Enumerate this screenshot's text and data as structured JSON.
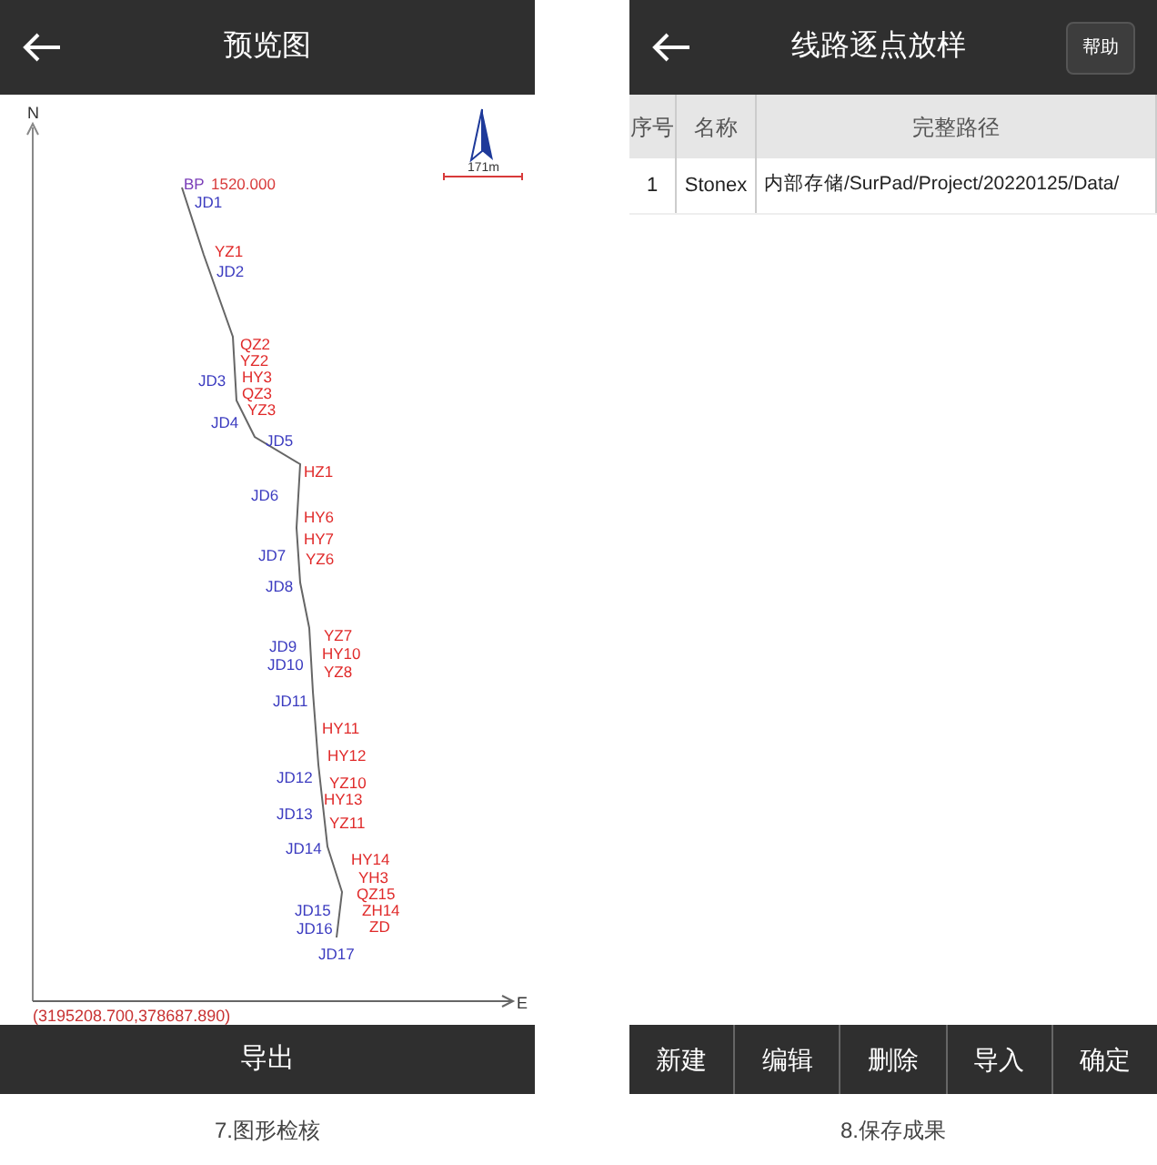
{
  "left_screen": {
    "title": "预览图",
    "map": {
      "north_label": "N",
      "east_label": "E",
      "scale": "171m",
      "coordinates": "(3195208.700,378687.890)",
      "labels": [
        {
          "text": "BP",
          "kind": "start"
        },
        {
          "text": "1520.000",
          "kind": "chainage"
        },
        {
          "text": "JD1",
          "kind": "jd"
        },
        {
          "text": "YZ1",
          "kind": "curve"
        },
        {
          "text": "JD2",
          "kind": "jd"
        },
        {
          "text": "QZ2",
          "kind": "curve"
        },
        {
          "text": "YZ2",
          "kind": "curve"
        },
        {
          "text": "JD3",
          "kind": "jd"
        },
        {
          "text": "HY3",
          "kind": "curve"
        },
        {
          "text": "QZ3",
          "kind": "curve"
        },
        {
          "text": "YZ3",
          "kind": "curve"
        },
        {
          "text": "JD4",
          "kind": "jd"
        },
        {
          "text": "JD5",
          "kind": "jd"
        },
        {
          "text": "HZ1",
          "kind": "curve"
        },
        {
          "text": "JD6",
          "kind": "jd"
        },
        {
          "text": "HY6",
          "kind": "curve"
        },
        {
          "text": "HY7",
          "kind": "curve"
        },
        {
          "text": "JD7",
          "kind": "jd"
        },
        {
          "text": "YZ6",
          "kind": "curve"
        },
        {
          "text": "JD8",
          "kind": "jd"
        },
        {
          "text": "YZ7",
          "kind": "curve"
        },
        {
          "text": "JD9",
          "kind": "jd"
        },
        {
          "text": "HY10",
          "kind": "curve"
        },
        {
          "text": "JD10",
          "kind": "jd"
        },
        {
          "text": "YZ8",
          "kind": "curve"
        },
        {
          "text": "JD11",
          "kind": "jd"
        },
        {
          "text": "HY11",
          "kind": "curve"
        },
        {
          "text": "HY12",
          "kind": "curve"
        },
        {
          "text": "JD12",
          "kind": "jd"
        },
        {
          "text": "YZ10",
          "kind": "curve"
        },
        {
          "text": "HY13",
          "kind": "curve"
        },
        {
          "text": "JD13",
          "kind": "jd"
        },
        {
          "text": "YZ11",
          "kind": "curve"
        },
        {
          "text": "JD14",
          "kind": "jd"
        },
        {
          "text": "HY14",
          "kind": "curve"
        },
        {
          "text": "YH3",
          "kind": "curve"
        },
        {
          "text": "QZ15",
          "kind": "curve"
        },
        {
          "text": "JD15",
          "kind": "jd"
        },
        {
          "text": "ZH14",
          "kind": "curve"
        },
        {
          "text": "JD16",
          "kind": "jd"
        },
        {
          "text": "ZD",
          "kind": "curve"
        },
        {
          "text": "JD17",
          "kind": "jd"
        }
      ]
    },
    "export_button": "导出",
    "caption": "7.图形检核"
  },
  "right_screen": {
    "title": "线路逐点放样",
    "help_button": "帮助",
    "table": {
      "columns": [
        "序号",
        "名称",
        "完整路径"
      ],
      "rows": [
        {
          "cells": [
            "1",
            "Stonex",
            "内部存储/SurPad/Project/20220125/Data/"
          ]
        }
      ]
    },
    "toolbar": [
      "新建",
      "编辑",
      "删除",
      "导入",
      "确定"
    ],
    "caption": "8.保存成果"
  }
}
